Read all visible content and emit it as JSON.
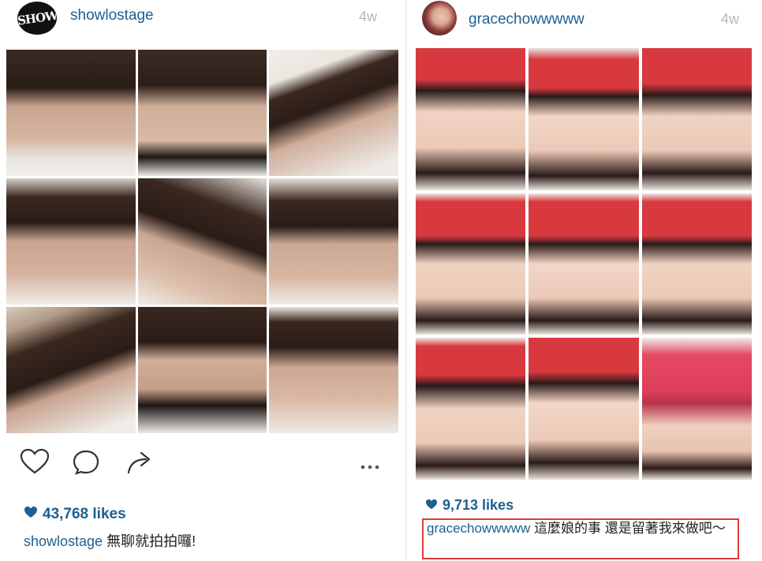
{
  "posts": [
    {
      "avatar_text": "SHOW",
      "username": "showlostage",
      "time": "4w",
      "likes": "43,768 likes",
      "caption_user": "showlostage",
      "caption_text": "無聊就拍拍囉!",
      "tile_count": 9
    },
    {
      "username": "gracechowwwww",
      "time": "4w",
      "likes": "9,713 likes",
      "caption_user": "gracechowwwww",
      "caption_text": "這麼娘的事 還是留著我來做吧～",
      "tile_count": 9
    }
  ],
  "colors": {
    "link": "#1f5f8f",
    "time": "#b8b8b8",
    "highlight_box": "#d93c3c",
    "hat_red": "#d8393f"
  }
}
